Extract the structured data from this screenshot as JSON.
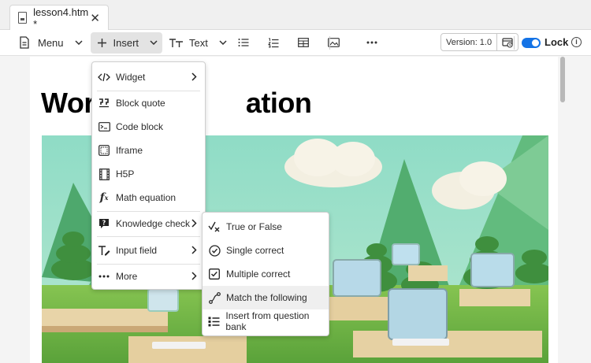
{
  "tab": {
    "title": "lesson4.htm *",
    "close": "✕"
  },
  "toolbar": {
    "menu_label": "Menu",
    "insert_label": "Insert",
    "text_label": "Text",
    "version_label": "Version: 1.0",
    "lock_label": "Lock",
    "lock_enabled": true,
    "accent_color": "#1473e6"
  },
  "document": {
    "title_visible": "Wor",
    "title_visible_end": "ation"
  },
  "insert_menu": {
    "items": [
      {
        "label": "Widget",
        "icon": "code-icon",
        "submenu": true
      },
      {
        "label": "Block quote",
        "icon": "quote-icon",
        "submenu": false
      },
      {
        "label": "Code block",
        "icon": "terminal-icon",
        "submenu": false
      },
      {
        "label": "Iframe",
        "icon": "iframe-icon",
        "submenu": false
      },
      {
        "label": "H5P",
        "icon": "film-icon",
        "submenu": false
      },
      {
        "label": "Math equation",
        "icon": "function-icon",
        "submenu": false
      },
      {
        "label": "Knowledge check",
        "icon": "question-icon",
        "submenu": true
      },
      {
        "label": "Input field",
        "icon": "text-input-icon",
        "submenu": true
      },
      {
        "label": "More",
        "icon": "more-icon",
        "submenu": true
      }
    ]
  },
  "knowledge_menu": {
    "items": [
      {
        "label": "True or False",
        "icon": "check-x-icon"
      },
      {
        "label": "Single correct",
        "icon": "circle-check-icon"
      },
      {
        "label": "Multiple correct",
        "icon": "checkbox-icon"
      },
      {
        "label": "Match the following",
        "icon": "match-icon",
        "highlighted": true
      },
      {
        "label": "Insert from question bank",
        "icon": "list-icon"
      }
    ]
  }
}
